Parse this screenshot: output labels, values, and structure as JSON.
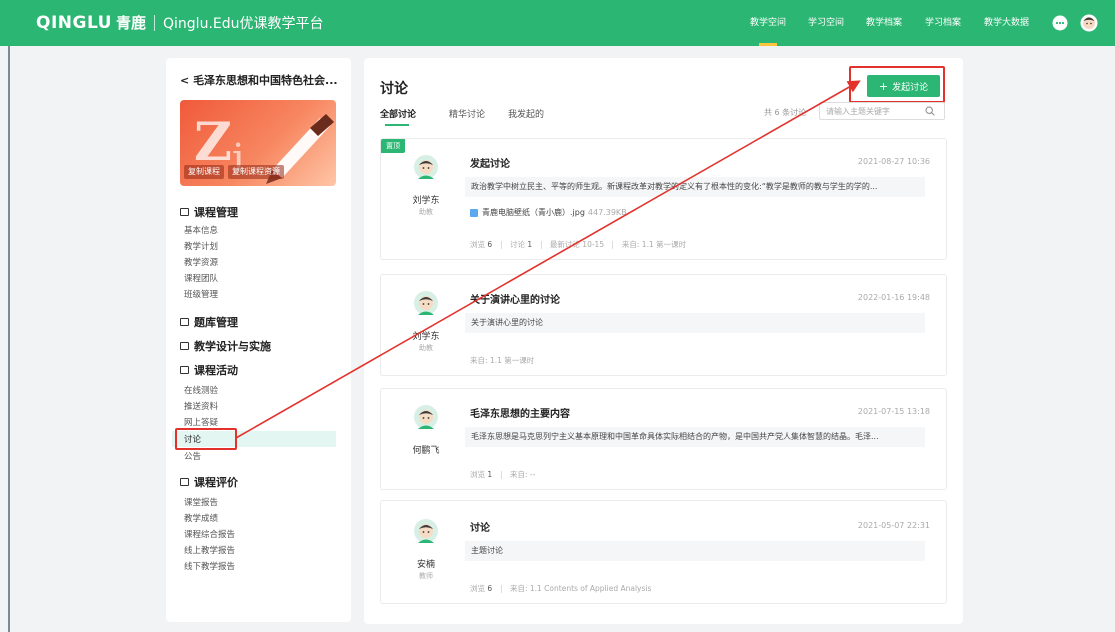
{
  "header": {
    "logo_text": "QINGLU",
    "logo_cn": "青鹿",
    "platform_name": "Qinglu.Edu优课教学平台",
    "nav": [
      "教学空间",
      "学习空间",
      "教学档案",
      "学习档案",
      "教学大数据"
    ],
    "active_nav": "教学空间"
  },
  "sidebar": {
    "course_title": "毛泽东思想和中国特色社会...",
    "banner_buttons": [
      "复制课程",
      "复制课程资源"
    ],
    "sections": [
      {
        "title": "课程管理",
        "items": [
          "基本信息",
          "教学计划",
          "教学资源",
          "课程团队",
          "班级管理"
        ]
      },
      {
        "title": "题库管理",
        "items": []
      },
      {
        "title": "教学设计与实施",
        "items": []
      },
      {
        "title": "课程活动",
        "items": [
          "在线测验",
          "推送资料",
          "网上答疑",
          "讨论",
          "公告"
        ]
      },
      {
        "title": "课程评价",
        "items": [
          "课堂报告",
          "教学成绩",
          "课程综合报告",
          "线上教学报告",
          "线下教学报告"
        ]
      }
    ],
    "active_item": "讨论"
  },
  "main": {
    "title": "讨论",
    "new_button": "发起讨论",
    "tabs": [
      "全部讨论",
      "精华讨论",
      "我发起的"
    ],
    "active_tab": "全部讨论",
    "count_text": "共 6 条讨论",
    "search_placeholder": "请输入主题关键字",
    "posts": [
      {
        "pinned_label": "置顶",
        "author": "刘学东",
        "role": "助教",
        "title": "发起讨论",
        "date": "2021-08-27 10:36",
        "body": "政治教学中树立民主、平等的师生观。新课程改革对教学的定义有了根本性的变化:“教学是教师的教与学生的学的...",
        "attachment": {
          "name": "青鹿电脑壁纸（青小鹿）.jpg",
          "size": "447.39KB"
        },
        "views_label": "浏览",
        "views": "6",
        "comments_label": "讨论",
        "comments": "1",
        "latest_label": "最新讨论",
        "latest": "10-15",
        "source_label": "来自:",
        "source": "1.1 第一课时"
      },
      {
        "author": "刘学东",
        "role": "助教",
        "title": "关于演讲心里的讨论",
        "date": "2022-01-16 19:48",
        "body": "关于演讲心里的讨论",
        "source_label": "来自:",
        "source": "1.1 第一课时"
      },
      {
        "author": "何鹏飞",
        "title": "毛泽东思想的主要内容",
        "date": "2021-07-15 13:18",
        "body": "毛泽东思想是马克思列宁主义基本原理和中国革命具体实际相结合的产物，是中国共产党人集体智慧的结晶。毛泽...",
        "views_label": "浏览",
        "views": "1",
        "source_label": "来自:",
        "source": "--"
      },
      {
        "author": "安楠",
        "role": "教师",
        "title": "讨论",
        "date": "2021-05-07 22:31",
        "body": "主题讨论",
        "views_label": "浏览",
        "views": "6",
        "source_label": "来自:",
        "source": "1.1 Contents of Applied Analysis"
      }
    ]
  },
  "colors": {
    "brand": "#2bb673",
    "highlight": "#e3312b",
    "active_bg": "#e4f6f1"
  }
}
